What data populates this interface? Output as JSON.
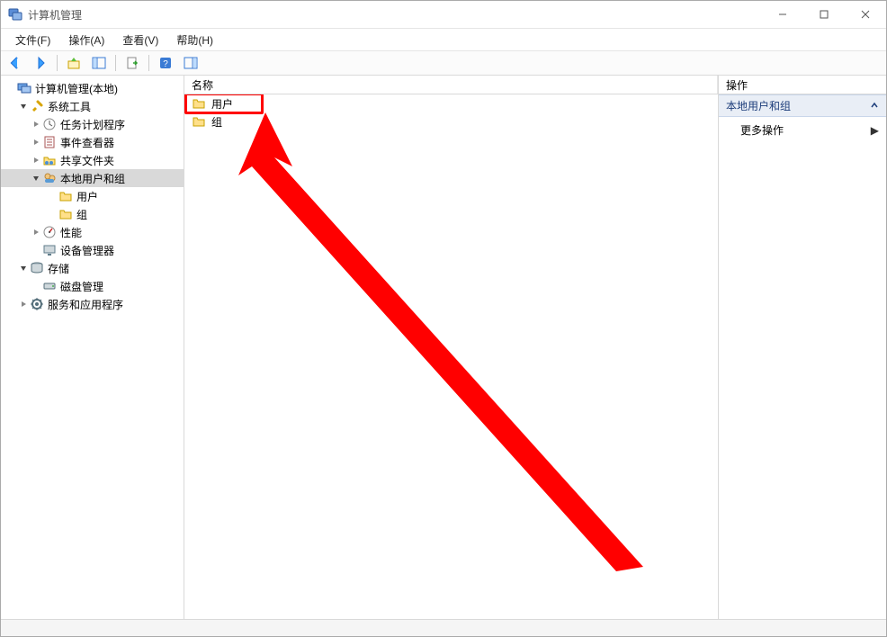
{
  "window": {
    "title": "计算机管理"
  },
  "menu": {
    "file": "文件(F)",
    "action": "操作(A)",
    "view": "查看(V)",
    "help": "帮助(H)"
  },
  "tree": {
    "root": "计算机管理(本地)",
    "system_tools": "系统工具",
    "task_scheduler": "任务计划程序",
    "event_viewer": "事件查看器",
    "shared_folders": "共享文件夹",
    "local_users_groups": "本地用户和组",
    "users": "用户",
    "groups": "组",
    "performance": "性能",
    "device_manager": "设备管理器",
    "storage": "存储",
    "disk_management": "磁盘管理",
    "services_apps": "服务和应用程序"
  },
  "list": {
    "header_name": "名称",
    "items": [
      {
        "label": "用户"
      },
      {
        "label": "组"
      }
    ]
  },
  "actions": {
    "header": "操作",
    "section": "本地用户和组",
    "more": "更多操作"
  }
}
